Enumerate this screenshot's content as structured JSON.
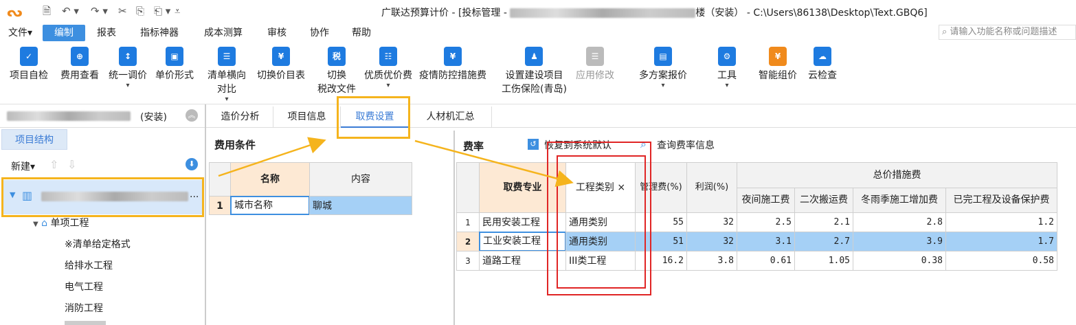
{
  "app": {
    "logo_glyph": "ᔓ",
    "title_prefix": "广联达预算计价 - [投标管理 - ",
    "title_suffix": "楼（安装） - C:\\Users\\86138\\Desktop\\Text.GBQ6]"
  },
  "quick_access": {
    "save": "🗎",
    "undo": "↶ ▾",
    "redo": "↷ ▾",
    "cut": "✂",
    "copy": "⎘",
    "paste": "⎗ ▾",
    "more": "⩡"
  },
  "menu": {
    "items": [
      "文件▾",
      "编制",
      "报表",
      "指标神器",
      "成本测算",
      "审核",
      "协作",
      "帮助"
    ],
    "search_placeholder": "请输入功能名称或问题描述"
  },
  "ribbon": {
    "buttons": [
      {
        "label": "项目自检",
        "icon": "check-icon"
      },
      {
        "label": "费用查看",
        "icon": "view-cost-icon"
      },
      {
        "label": "统一调价",
        "icon": "adjust-price-icon",
        "dropdown": "▾"
      },
      {
        "label": "单价形式",
        "icon": "unit-price-icon"
      },
      {
        "label": "清单横向",
        "label2": "对比",
        "icon": "compare-icon",
        "dropdown": "▾"
      },
      {
        "label": "切换价目表",
        "icon": "price-table-icon"
      },
      {
        "label": "切换",
        "label2": "税改文件",
        "icon": "tax-icon"
      },
      {
        "label": "优质优价费",
        "icon": "quality-icon",
        "dropdown": "▾"
      },
      {
        "label": "疫情防控措施费",
        "icon": "epidemic-icon"
      },
      {
        "label": "设置建设项目",
        "label2": "工伤保险(青岛)",
        "icon": "insurance-icon"
      },
      {
        "label": "应用修改",
        "icon": "apply-icon"
      },
      {
        "label": "多方案报价",
        "icon": "multi-quote-icon",
        "dropdown": "▾"
      },
      {
        "label": "工具",
        "icon": "tools-icon",
        "dropdown": "▾"
      },
      {
        "label": "智能组价",
        "icon": "smart-icon"
      },
      {
        "label": "云检查",
        "icon": "cloud-check-icon"
      }
    ]
  },
  "left_panel": {
    "project_suffix": "(安装)",
    "tab": "项目结构",
    "new_label": "新建▾",
    "tree": [
      {
        "label": "单项工程"
      },
      {
        "label": "※清单给定格式"
      },
      {
        "label": "给排水工程"
      },
      {
        "label": "电气工程"
      },
      {
        "label": "消防工程"
      }
    ]
  },
  "tabs": [
    "造价分析",
    "项目信息",
    "取费设置",
    "人材机汇总"
  ],
  "fee_conditions": {
    "heading": "费用条件",
    "headers": [
      "名称",
      "内容"
    ],
    "rows": [
      {
        "idx": "1",
        "name": "城市名称",
        "content": "聊城"
      }
    ]
  },
  "fee_rates": {
    "heading": "费率",
    "restore_label": "恢复到系统默认",
    "query_label": "查询费率信息",
    "headers": {
      "specialty": "取费专业",
      "category": "工程类别",
      "mgmt": "管理费(%)",
      "profit": "利润(%)",
      "group": "总价措施费",
      "sub": [
        "夜间施工费",
        "二次搬运费",
        "冬雨季施工增加费",
        "已完工程及设备保护费"
      ]
    },
    "rows": [
      {
        "idx": "1",
        "specialty": "民用安装工程",
        "category": "通用类别",
        "mgmt": "55",
        "profit": "32",
        "v": [
          "2.5",
          "2.1",
          "2.8",
          "1.2"
        ]
      },
      {
        "idx": "2",
        "specialty": "工业安装工程",
        "category": "通用类别",
        "mgmt": "51",
        "profit": "32",
        "v": [
          "3.1",
          "2.7",
          "3.9",
          "1.7"
        ]
      },
      {
        "idx": "3",
        "specialty": "道路工程",
        "category": "III类工程",
        "mgmt": "16.2",
        "profit": "3.8",
        "v": [
          "0.61",
          "1.05",
          "0.38",
          "0.58"
        ]
      }
    ]
  },
  "colors": {
    "accent": "#3d8fe0",
    "highlight_orange": "#f5b41d",
    "highlight_red": "#e02424",
    "selected_row": "#a5d0f6"
  }
}
